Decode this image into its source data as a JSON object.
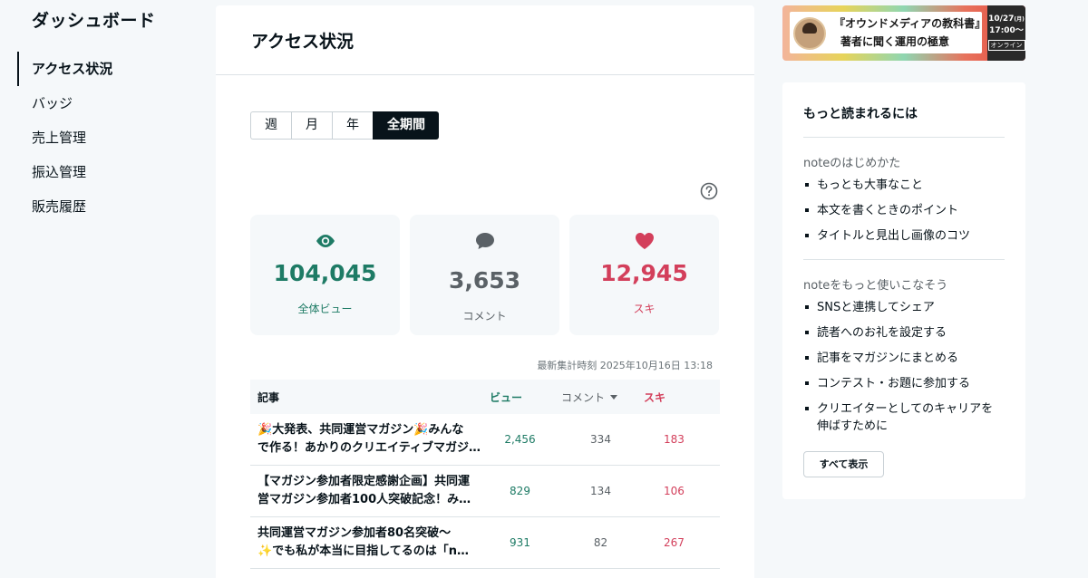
{
  "sidebar": {
    "title": "ダッシュボード",
    "items": [
      {
        "label": "アクセス状況",
        "active": true
      },
      {
        "label": "バッジ"
      },
      {
        "label": "売上管理"
      },
      {
        "label": "振込管理"
      },
      {
        "label": "販売履歴"
      }
    ]
  },
  "main": {
    "title": "アクセス状況",
    "tabs": [
      "週",
      "月",
      "年",
      "全期間"
    ],
    "active_tab": "全期間",
    "stats": {
      "views": {
        "value": "104,045",
        "label": "全体ビュー"
      },
      "comments": {
        "value": "3,653",
        "label": "コメント"
      },
      "likes": {
        "value": "12,945",
        "label": "スキ"
      }
    },
    "updated": "最新集計時刻 2025年10月16日 13:18",
    "table": {
      "headers": {
        "title": "記事",
        "views": "ビュー",
        "comments": "コメント",
        "likes": "スキ"
      },
      "rows": [
        {
          "title_line1": "大発表、共同運営マガジン",
          "title_line1b": "みんな",
          "title_line2": "で作る！あかりのクリエイティブマガジ…",
          "views": "2,456",
          "comments": "334",
          "likes": "183"
        },
        {
          "title_line1": "【マガジン参加者限定感謝企画】共同運",
          "title_line2": "営マガジン参加者100人突破記念！み…",
          "views": "829",
          "comments": "134",
          "likes": "106"
        },
        {
          "title_line1": "共同運営マガジン参加者80名突破〜",
          "title_line2": "でも私が本当に目指してるのは「n…",
          "views": "931",
          "comments": "82",
          "likes": "267"
        }
      ]
    }
  },
  "banner": {
    "title": "『オウンドメディアの教科書』",
    "subtitle": "著者に聞く運用の極意",
    "date": "10/27",
    "weekday": "(月)",
    "time": "17:00〜",
    "online": "オンライン"
  },
  "tips": {
    "title": "もっと読まれるには",
    "sections": [
      {
        "heading": "noteのはじめかた",
        "items": [
          "もっとも大事なこと",
          "本文を書くときのポイント",
          "タイトルと見出し画像のコツ"
        ]
      },
      {
        "heading": "noteをもっと使いこなそう",
        "items": [
          "SNSと連携してシェア",
          "読者へのお礼を設定する",
          "記事をマガジンにまとめる",
          "コンテスト・お題に参加する",
          "クリエイターとしてのキャリアを伸ばすために"
        ]
      }
    ],
    "show_all": "すべて表示"
  },
  "colors": {
    "views": "#1e7b65",
    "likes": "#d33f5b",
    "comments": "#5a6166",
    "text": "#08131a"
  }
}
